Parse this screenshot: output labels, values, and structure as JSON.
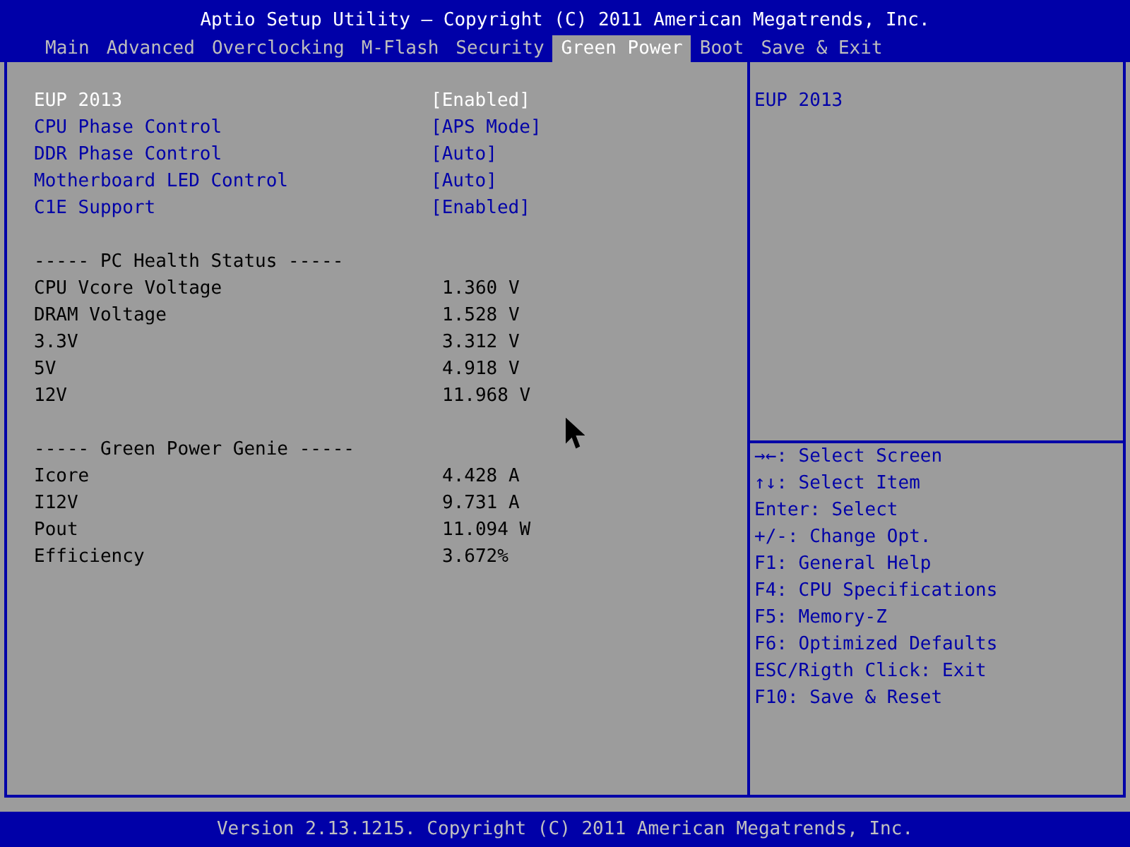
{
  "header": {
    "title": "Aptio Setup Utility – Copyright (C) 2011 American Megatrends, Inc."
  },
  "tabs": [
    {
      "label": "Main",
      "selected": false
    },
    {
      "label": "Advanced",
      "selected": false
    },
    {
      "label": "Overclocking",
      "selected": false
    },
    {
      "label": "M-Flash",
      "selected": false
    },
    {
      "label": "Security",
      "selected": false
    },
    {
      "label": "Green Power",
      "selected": true
    },
    {
      "label": "Boot",
      "selected": false
    },
    {
      "label": "Save & Exit",
      "selected": false
    }
  ],
  "settings": [
    {
      "label": "EUP 2013",
      "value": "[Enabled]",
      "selected": true
    },
    {
      "label": "CPU Phase Control",
      "value": "[APS Mode]",
      "selected": false
    },
    {
      "label": "DDR Phase Control",
      "value": "[Auto]",
      "selected": false
    },
    {
      "label": "Motherboard LED Control",
      "value": "[Auto]",
      "selected": false
    },
    {
      "label": "C1E Support",
      "value": "[Enabled]",
      "selected": false
    }
  ],
  "sections": [
    {
      "title": "----- PC Health Status -----",
      "readings": [
        {
          "label": "CPU Vcore Voltage",
          "value": "1.360 V"
        },
        {
          "label": "DRAM Voltage",
          "value": "1.528 V"
        },
        {
          "label": "3.3V",
          "value": "3.312 V"
        },
        {
          "label": "5V",
          "value": "4.918 V"
        },
        {
          "label": "12V",
          "value": "11.968 V"
        }
      ]
    },
    {
      "title": "----- Green Power Genie -----",
      "readings": [
        {
          "label": "Icore",
          "value": "4.428 A"
        },
        {
          "label": "I12V",
          "value": "9.731 A"
        },
        {
          "label": "Pout",
          "value": "11.094 W"
        },
        {
          "label": "Efficiency",
          "value": "3.672%"
        }
      ]
    }
  ],
  "help": {
    "text": "EUP 2013"
  },
  "keys": [
    "→←: Select Screen",
    "↑↓: Select Item",
    "Enter: Select",
    "+/-: Change Opt.",
    "F1: General Help",
    "F4: CPU Specifications",
    "F5: Memory-Z",
    "F6: Optimized Defaults",
    "ESC/Rigth Click: Exit",
    "F10: Save & Reset"
  ],
  "footer": {
    "text": "Version 2.13.1215. Copyright (C) 2011 American Megatrends, Inc."
  }
}
